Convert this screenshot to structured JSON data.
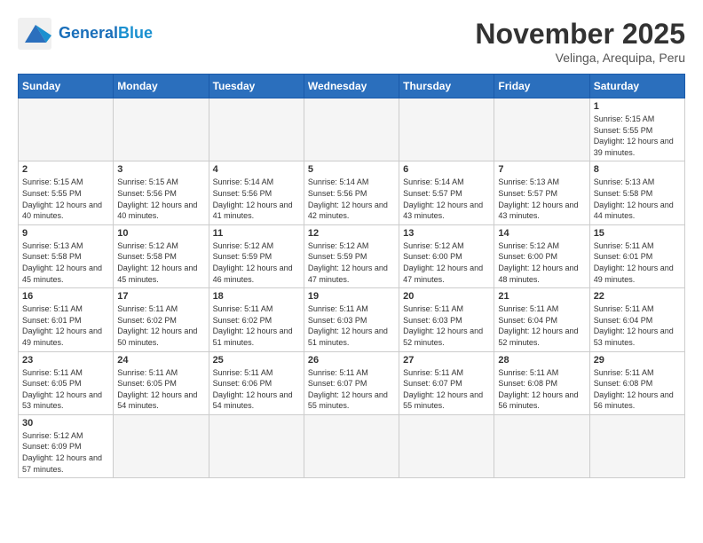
{
  "header": {
    "logo_line1": "General",
    "logo_line2": "Blue",
    "month_title": "November 2025",
    "subtitle": "Velinga, Arequipa, Peru"
  },
  "weekdays": [
    "Sunday",
    "Monday",
    "Tuesday",
    "Wednesday",
    "Thursday",
    "Friday",
    "Saturday"
  ],
  "weeks": [
    [
      {
        "day": "",
        "info": ""
      },
      {
        "day": "",
        "info": ""
      },
      {
        "day": "",
        "info": ""
      },
      {
        "day": "",
        "info": ""
      },
      {
        "day": "",
        "info": ""
      },
      {
        "day": "",
        "info": ""
      },
      {
        "day": "1",
        "info": "Sunrise: 5:15 AM\nSunset: 5:55 PM\nDaylight: 12 hours and 39 minutes."
      }
    ],
    [
      {
        "day": "2",
        "info": "Sunrise: 5:15 AM\nSunset: 5:55 PM\nDaylight: 12 hours and 40 minutes."
      },
      {
        "day": "3",
        "info": "Sunrise: 5:15 AM\nSunset: 5:56 PM\nDaylight: 12 hours and 40 minutes."
      },
      {
        "day": "4",
        "info": "Sunrise: 5:14 AM\nSunset: 5:56 PM\nDaylight: 12 hours and 41 minutes."
      },
      {
        "day": "5",
        "info": "Sunrise: 5:14 AM\nSunset: 5:56 PM\nDaylight: 12 hours and 42 minutes."
      },
      {
        "day": "6",
        "info": "Sunrise: 5:14 AM\nSunset: 5:57 PM\nDaylight: 12 hours and 43 minutes."
      },
      {
        "day": "7",
        "info": "Sunrise: 5:13 AM\nSunset: 5:57 PM\nDaylight: 12 hours and 43 minutes."
      },
      {
        "day": "8",
        "info": "Sunrise: 5:13 AM\nSunset: 5:58 PM\nDaylight: 12 hours and 44 minutes."
      }
    ],
    [
      {
        "day": "9",
        "info": "Sunrise: 5:13 AM\nSunset: 5:58 PM\nDaylight: 12 hours and 45 minutes."
      },
      {
        "day": "10",
        "info": "Sunrise: 5:12 AM\nSunset: 5:58 PM\nDaylight: 12 hours and 45 minutes."
      },
      {
        "day": "11",
        "info": "Sunrise: 5:12 AM\nSunset: 5:59 PM\nDaylight: 12 hours and 46 minutes."
      },
      {
        "day": "12",
        "info": "Sunrise: 5:12 AM\nSunset: 5:59 PM\nDaylight: 12 hours and 47 minutes."
      },
      {
        "day": "13",
        "info": "Sunrise: 5:12 AM\nSunset: 6:00 PM\nDaylight: 12 hours and 47 minutes."
      },
      {
        "day": "14",
        "info": "Sunrise: 5:12 AM\nSunset: 6:00 PM\nDaylight: 12 hours and 48 minutes."
      },
      {
        "day": "15",
        "info": "Sunrise: 5:11 AM\nSunset: 6:01 PM\nDaylight: 12 hours and 49 minutes."
      }
    ],
    [
      {
        "day": "16",
        "info": "Sunrise: 5:11 AM\nSunset: 6:01 PM\nDaylight: 12 hours and 49 minutes."
      },
      {
        "day": "17",
        "info": "Sunrise: 5:11 AM\nSunset: 6:02 PM\nDaylight: 12 hours and 50 minutes."
      },
      {
        "day": "18",
        "info": "Sunrise: 5:11 AM\nSunset: 6:02 PM\nDaylight: 12 hours and 51 minutes."
      },
      {
        "day": "19",
        "info": "Sunrise: 5:11 AM\nSunset: 6:03 PM\nDaylight: 12 hours and 51 minutes."
      },
      {
        "day": "20",
        "info": "Sunrise: 5:11 AM\nSunset: 6:03 PM\nDaylight: 12 hours and 52 minutes."
      },
      {
        "day": "21",
        "info": "Sunrise: 5:11 AM\nSunset: 6:04 PM\nDaylight: 12 hours and 52 minutes."
      },
      {
        "day": "22",
        "info": "Sunrise: 5:11 AM\nSunset: 6:04 PM\nDaylight: 12 hours and 53 minutes."
      }
    ],
    [
      {
        "day": "23",
        "info": "Sunrise: 5:11 AM\nSunset: 6:05 PM\nDaylight: 12 hours and 53 minutes."
      },
      {
        "day": "24",
        "info": "Sunrise: 5:11 AM\nSunset: 6:05 PM\nDaylight: 12 hours and 54 minutes."
      },
      {
        "day": "25",
        "info": "Sunrise: 5:11 AM\nSunset: 6:06 PM\nDaylight: 12 hours and 54 minutes."
      },
      {
        "day": "26",
        "info": "Sunrise: 5:11 AM\nSunset: 6:07 PM\nDaylight: 12 hours and 55 minutes."
      },
      {
        "day": "27",
        "info": "Sunrise: 5:11 AM\nSunset: 6:07 PM\nDaylight: 12 hours and 55 minutes."
      },
      {
        "day": "28",
        "info": "Sunrise: 5:11 AM\nSunset: 6:08 PM\nDaylight: 12 hours and 56 minutes."
      },
      {
        "day": "29",
        "info": "Sunrise: 5:11 AM\nSunset: 6:08 PM\nDaylight: 12 hours and 56 minutes."
      }
    ],
    [
      {
        "day": "30",
        "info": "Sunrise: 5:12 AM\nSunset: 6:09 PM\nDaylight: 12 hours and 57 minutes."
      },
      {
        "day": "",
        "info": ""
      },
      {
        "day": "",
        "info": ""
      },
      {
        "day": "",
        "info": ""
      },
      {
        "day": "",
        "info": ""
      },
      {
        "day": "",
        "info": ""
      },
      {
        "day": "",
        "info": ""
      }
    ]
  ]
}
